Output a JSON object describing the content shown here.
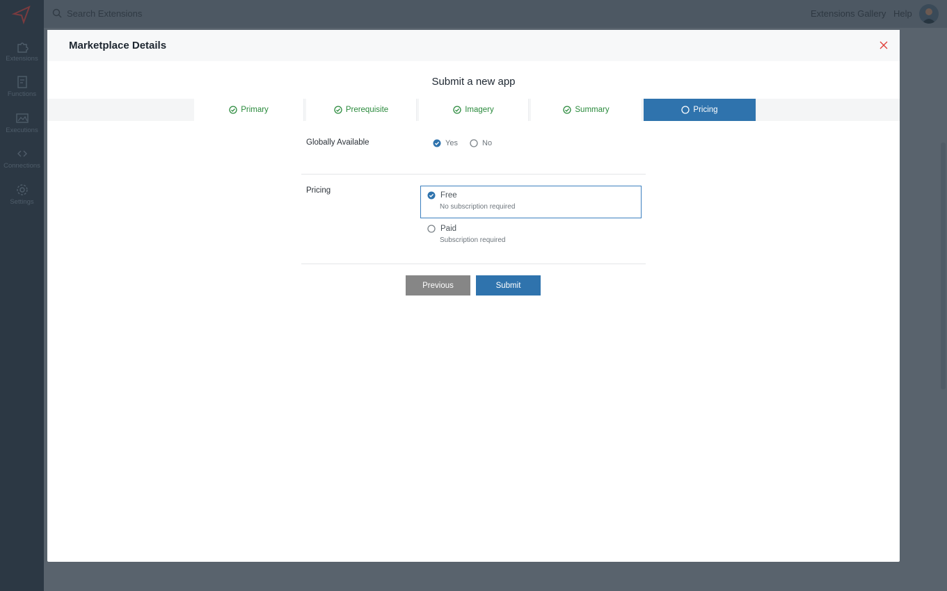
{
  "search": {
    "placeholder": "Search Extensions"
  },
  "topbar": {
    "gallery_link": "Extensions Gallery",
    "help_link": "Help"
  },
  "sidebar": {
    "items": [
      {
        "label": "Extensions",
        "icon": "puzzle-icon"
      },
      {
        "label": "Functions",
        "icon": "function-icon"
      },
      {
        "label": "Executions",
        "icon": "executions-icon"
      },
      {
        "label": "Connections",
        "icon": "connections-icon"
      },
      {
        "label": "Settings",
        "icon": "gear-icon"
      }
    ]
  },
  "modal": {
    "title": "Marketplace Details",
    "heading": "Submit a new app",
    "steps": [
      {
        "label": "Primary",
        "status": "complete"
      },
      {
        "label": "Prerequisite",
        "status": "complete"
      },
      {
        "label": "Imagery",
        "status": "complete"
      },
      {
        "label": "Summary",
        "status": "complete"
      },
      {
        "label": "Pricing",
        "status": "active"
      }
    ],
    "globally_available": {
      "label": "Globally Available",
      "options": [
        "Yes",
        "No"
      ],
      "selected": "Yes"
    },
    "pricing": {
      "label": "Pricing",
      "options": [
        {
          "title": "Free",
          "subtitle": "No subscription required",
          "selected": true
        },
        {
          "title": "Paid",
          "subtitle": "Subscription required",
          "selected": false
        }
      ]
    },
    "buttons": {
      "previous": "Previous",
      "submit": "Submit"
    }
  },
  "colors": {
    "accent": "#2f73ad",
    "complete": "#2a8a3c",
    "close": "#e0403a"
  }
}
